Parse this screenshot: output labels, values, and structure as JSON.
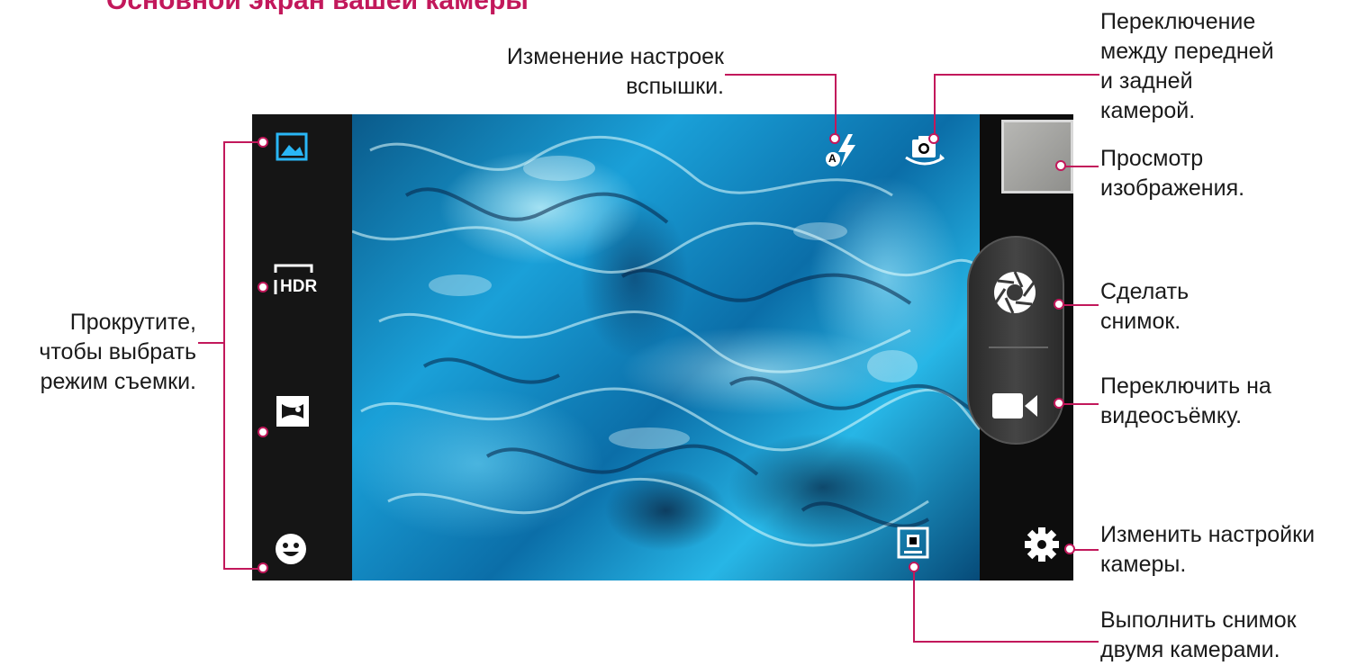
{
  "heading": "Основной экран вашей камеры",
  "annotations": {
    "flash": [
      "Изменение настроек",
      "вспышки."
    ],
    "switch_camera": [
      "Переключение",
      "между передней",
      "и задней",
      "камерой."
    ],
    "preview": [
      "Просмотр",
      "изображения."
    ],
    "take_photo": [
      "Сделать",
      "снимок."
    ],
    "video": [
      "Переключить на",
      "видеосъёмку."
    ],
    "settings": [
      "Изменить настройки",
      "камеры."
    ],
    "dual": [
      "Выполнить снимок",
      "двумя камерами."
    ],
    "modes": [
      "Прокрутите,",
      "чтобы выбрать",
      "режим съемки."
    ]
  },
  "camera_ui": {
    "hdr_label": "HDR",
    "flash_mode_label": "A"
  },
  "colors": {
    "accent": "#c2185b",
    "mode_selected": "#29b6f6"
  },
  "icons": {
    "mode_picture": "picture-icon",
    "mode_hdr": "hdr-icon",
    "mode_panorama": "panorama-icon",
    "mode_face": "smiley-icon",
    "flash": "flash-auto-icon",
    "switch_camera": "switch-camera-icon",
    "shutter": "shutter-icon",
    "video": "video-camera-icon",
    "settings": "gear-icon",
    "dual": "dual-camera-icon"
  }
}
